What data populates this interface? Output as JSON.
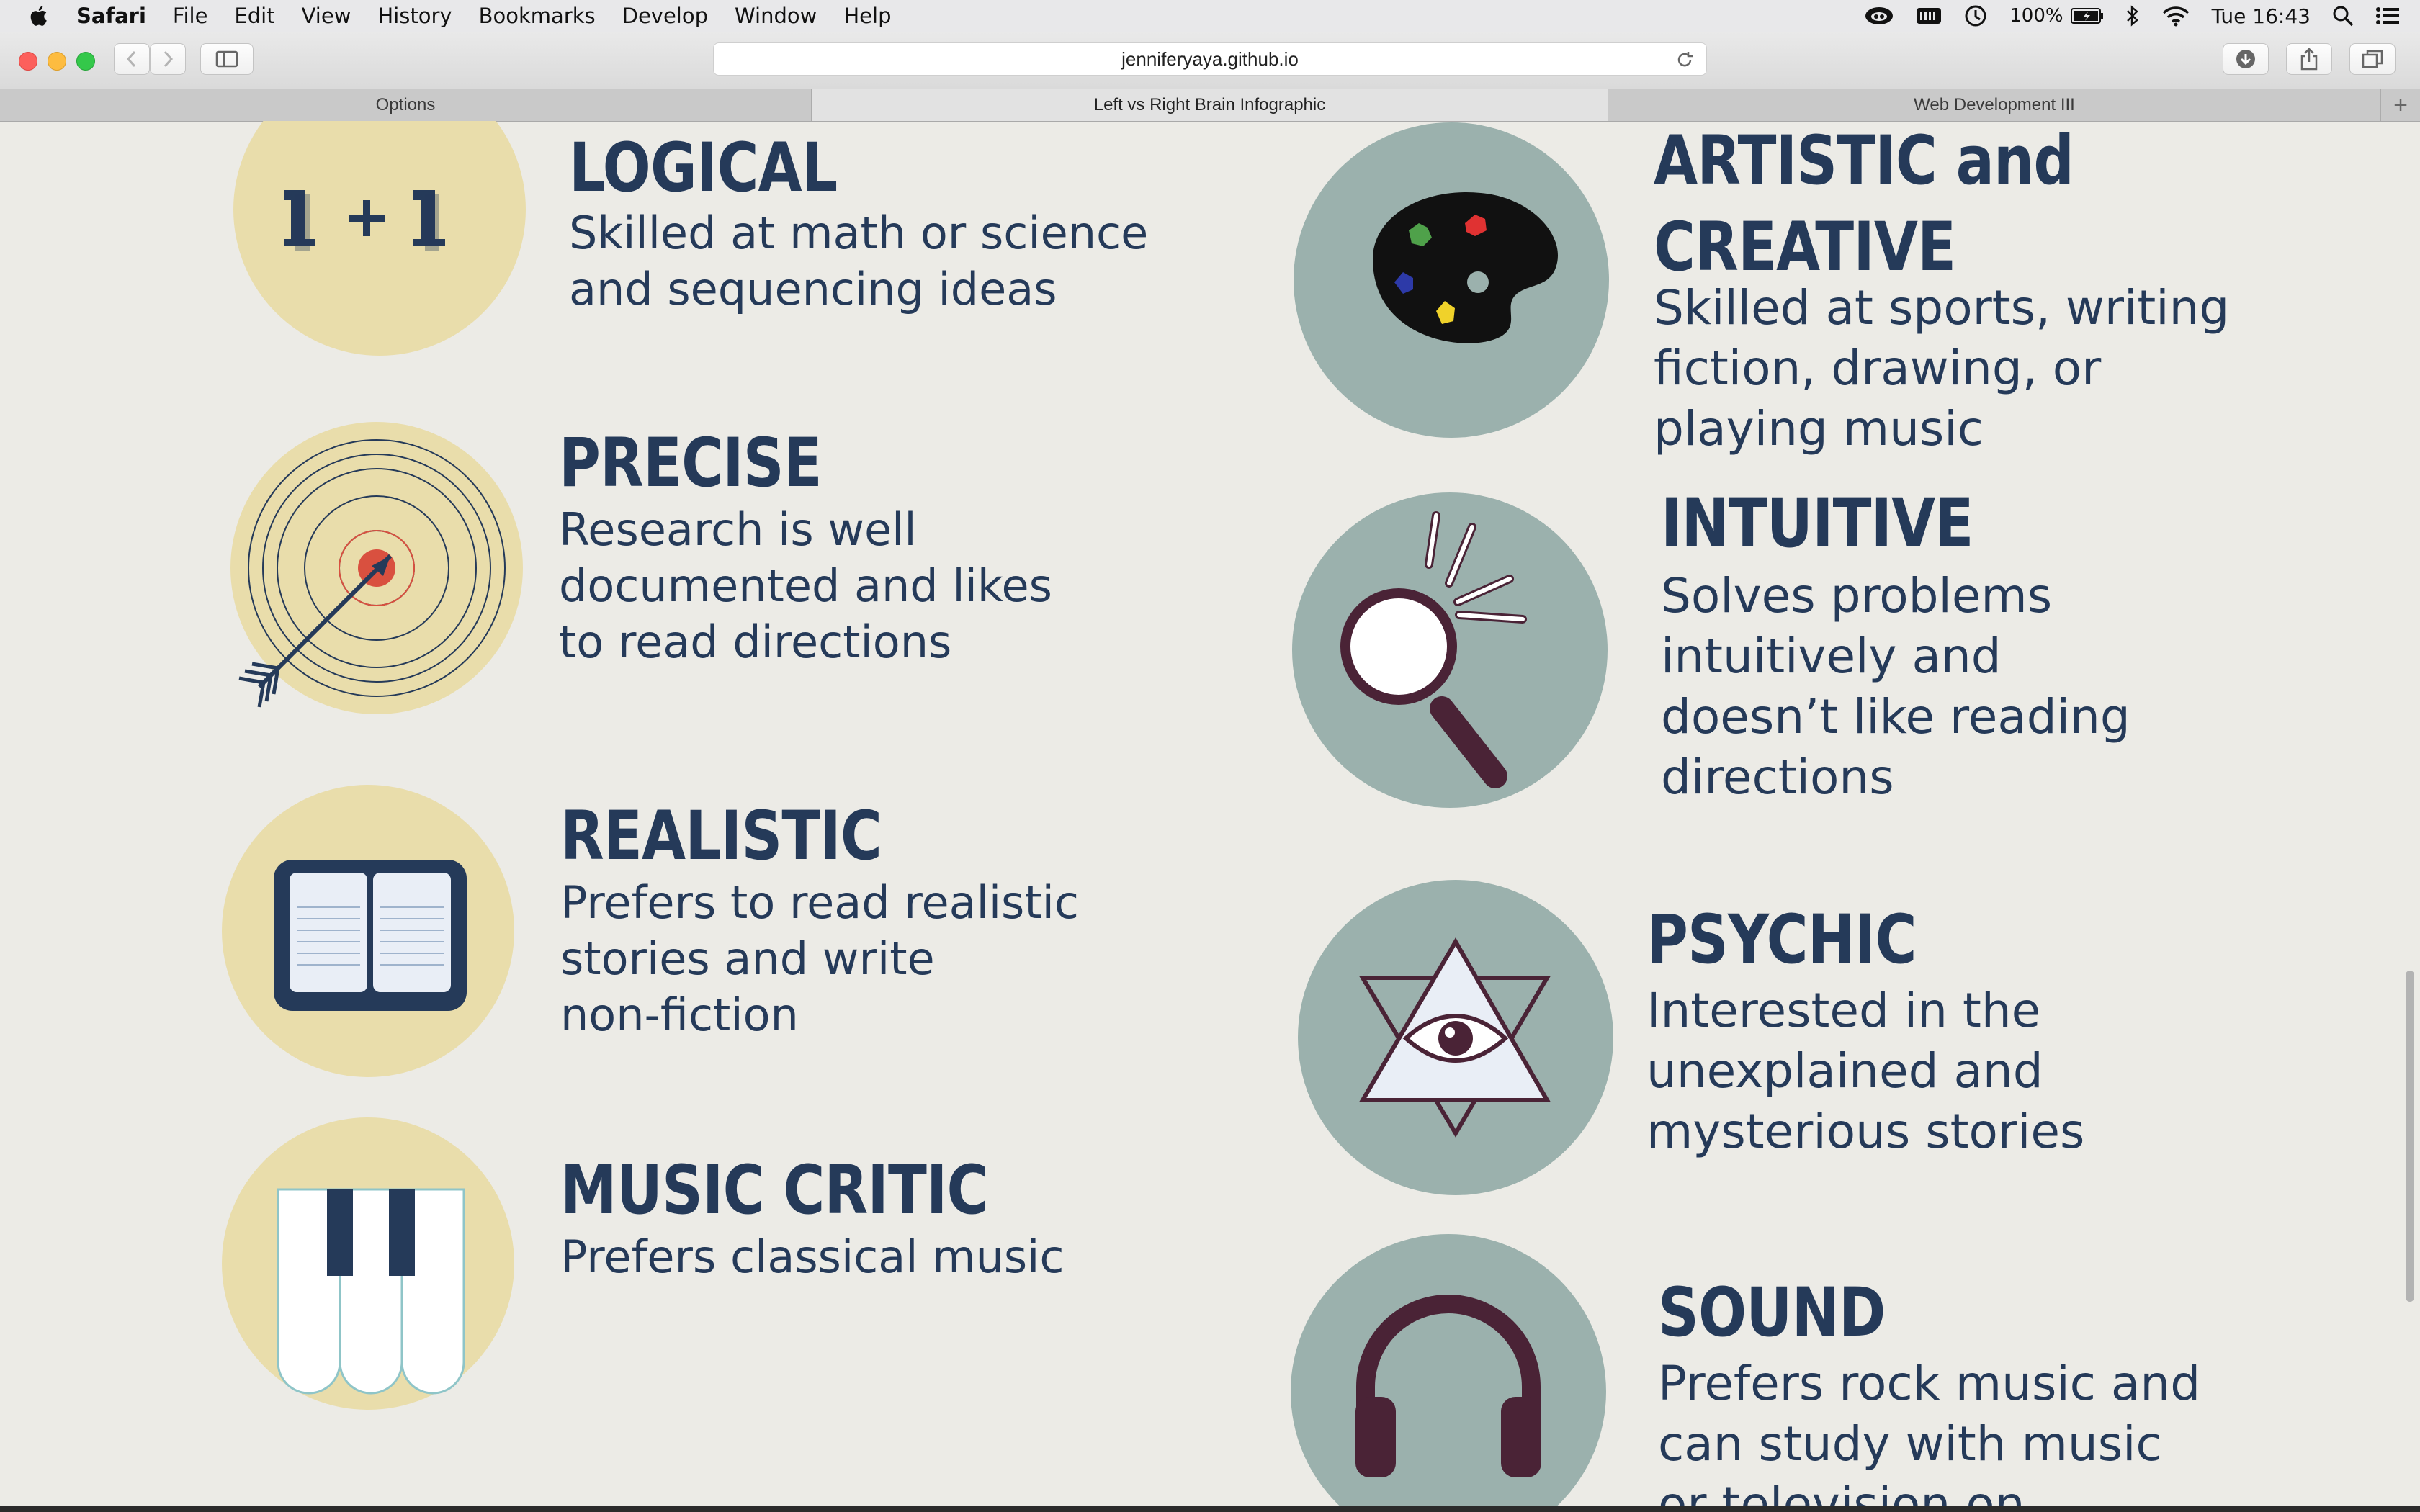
{
  "menubar": {
    "app": "Safari",
    "items": [
      "File",
      "Edit",
      "View",
      "History",
      "Bookmarks",
      "Develop",
      "Window",
      "Help"
    ],
    "battery_percent": "100%",
    "clock": "Tue 16:43"
  },
  "browser": {
    "url": "jenniferyaya.github.io",
    "tabs": [
      {
        "label": "Options",
        "active": false
      },
      {
        "label": "Left vs Right Brain Infographic",
        "active": true
      },
      {
        "label": "Web Development III",
        "active": false
      }
    ]
  },
  "left_traits": [
    {
      "title": "LOGICAL",
      "lines": [
        "Skilled at math or science",
        "and sequencing ideas"
      ],
      "icon": "one-plus-one-icon"
    },
    {
      "title": "PRECISE",
      "lines": [
        "Research is well",
        "documented and likes",
        "to read directions"
      ],
      "icon": "target-arrow-icon"
    },
    {
      "title": "REALISTIC",
      "lines": [
        "Prefers to read realistic",
        "stories and write",
        "non-fiction"
      ],
      "icon": "open-book-icon"
    },
    {
      "title": "MUSIC CRITIC",
      "lines": [
        "Prefers classical music"
      ],
      "icon": "piano-keys-icon"
    }
  ],
  "right_traits": [
    {
      "title_lines": [
        "ARTISTIC and",
        "CREATIVE"
      ],
      "lines": [
        "Skilled at sports, writing",
        "fiction, drawing, or",
        "playing music"
      ],
      "icon": "paint-palette-icon"
    },
    {
      "title": "INTUITIVE",
      "lines": [
        "Solves problems",
        "intuitively and",
        "doesn’t like reading",
        "directions"
      ],
      "icon": "magnifying-glass-icon"
    },
    {
      "title": "PSYCHIC",
      "lines": [
        "Interested in the",
        "unexplained and",
        "mysterious stories"
      ],
      "icon": "all-seeing-eye-icon"
    },
    {
      "title": "SOUND",
      "lines": [
        "Prefers rock music and",
        "can study with music",
        "or television on"
      ],
      "icon": "headphones-icon"
    }
  ],
  "colors": {
    "page_bg": "#ecebe6",
    "left_circle": "#e9ddab",
    "right_circle": "#9bb1ad",
    "text_navy": "#253a59",
    "accent_red": "#d9503f",
    "accent_maroon": "#4a2336"
  }
}
